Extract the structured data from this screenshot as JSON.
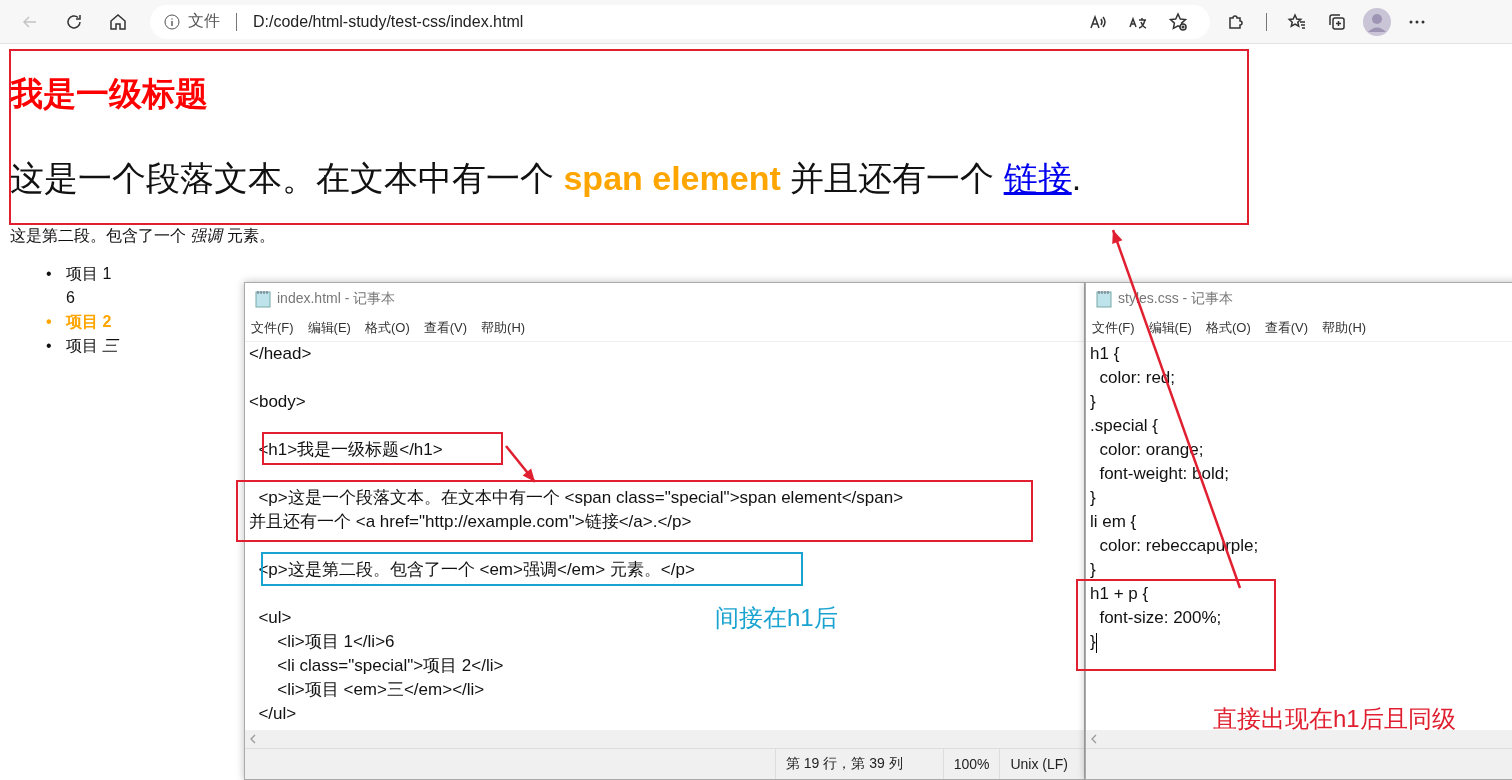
{
  "browser": {
    "back_disabled": true,
    "address": {
      "scheme_label": "文件",
      "url": "D:/code/html-study/test-css/index.html"
    }
  },
  "page": {
    "heading": "我是一级标题",
    "paragraph": [
      {
        "kind": "text",
        "text": "这是一个段落文本。在文本中有一个 "
      },
      {
        "kind": "special",
        "text": "span element"
      },
      {
        "kind": "text",
        "text": " 并且还有一个 "
      },
      {
        "kind": "link",
        "text": "链接"
      },
      {
        "kind": "text",
        "text": "."
      }
    ],
    "paragraph2": "这是第二段。包含了一个 *强调* 元素。",
    "list": [
      {
        "marker": "•",
        "text": "项目 1",
        "special": false,
        "after": "6"
      },
      {
        "marker": "•",
        "text": "项目 2",
        "special": true
      },
      {
        "marker": "•",
        "text": "项目 *三*",
        "special": false
      }
    ]
  },
  "notepads": [
    {
      "title": "index.html - 记事本",
      "menu": [
        "文件(F)",
        "编辑(E)",
        "格式(O)",
        "查看(V)",
        "帮助(H)"
      ],
      "blocks": [
        [
          "</head>"
        ],
        [
          "<body>"
        ],
        [
          "  <h1>我是一级标题</h1>"
        ],
        [
          "  <p>这是一个段落文本。在文本中有一个 <span class=\"special\">span element</span>",
          "并且还有一个 <a href=\"http://example.com\">链接</a>.</p>"
        ],
        [
          "  <p>这是第二段。包含了一个 <em>强调</em> 元素。</p>"
        ],
        [
          "  <ul>",
          "      <li>项目 1</li>6",
          "      <li class=\"special\">项目 2</li>",
          "      <li>项目 <em>三</em></li>",
          "  </ul>"
        ]
      ],
      "status": [
        "第 19 行，第 39 列",
        "100%",
        "Unix (LF)"
      ]
    },
    {
      "title": "styles.css - 记事本",
      "menu": [
        "文件(F)",
        "编辑(E)",
        "格式(O)",
        "查看(V)",
        "帮助(H)"
      ],
      "blocks": [
        [
          "h1 {",
          "  color: red;",
          "}",
          ".special {",
          "  color: orange;",
          "  font-weight: bold;",
          "}",
          "li em {",
          "  color: rebeccapurple;",
          "}",
          "h1 + p {",
          "  font-size: 200%;",
          "}"
        ]
      ]
    }
  ],
  "annotations": {
    "boxes": [
      {
        "color": "#e02030"
      },
      {
        "color": "#e02030"
      },
      {
        "color": "#e02030"
      },
      {
        "color": "#1aa3d0"
      },
      {
        "color": "#e02030"
      }
    ],
    "labels": [
      {
        "text": "间接在h1后",
        "color": "#1aa3d0"
      },
      {
        "text": "直接出现在h1后且同级",
        "color": "#e02030"
      }
    ]
  }
}
